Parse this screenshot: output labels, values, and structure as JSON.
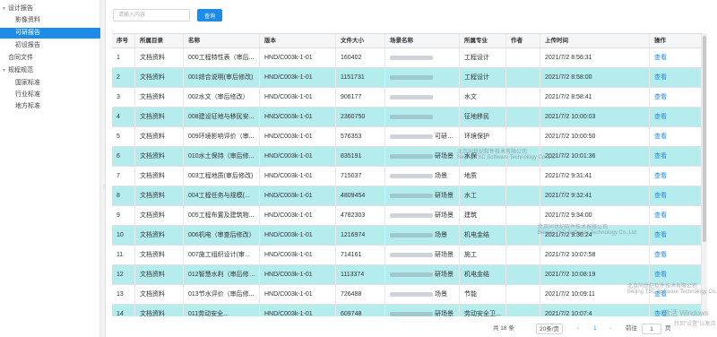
{
  "sidebar": {
    "items": [
      {
        "label": "设计报告",
        "level": 0,
        "expanded": true
      },
      {
        "label": "影像资料",
        "level": 1
      },
      {
        "label": "可研报告",
        "level": 1,
        "active": true
      },
      {
        "label": "初设报告",
        "level": 1
      },
      {
        "label": "合同文件",
        "level": 0
      },
      {
        "label": "规程规范",
        "level": 0,
        "expanded": true
      },
      {
        "label": "国家标准",
        "level": 1
      },
      {
        "label": "行业标准",
        "level": 1
      },
      {
        "label": "地方标准",
        "level": 1
      }
    ]
  },
  "search": {
    "placeholder": "请输入内容",
    "button_label": "查询"
  },
  "table": {
    "columns": [
      "序号",
      "所属目录",
      "名称",
      "版本",
      "文件大小",
      "场景名称",
      "所属专业",
      "作者",
      "上传时间",
      "操作"
    ],
    "rows": [
      {
        "no": "1",
        "dir": "文档资料",
        "name": "000工程特性表（审后...",
        "ver": "HND/C003k-1-01",
        "size": "160402",
        "scene": "",
        "major": "工程设计",
        "author": "",
        "time": "2021/7/2 8:56:31",
        "op": "查看"
      },
      {
        "no": "2",
        "dir": "文档资料",
        "name": "001综合说明(审后修改)",
        "ver": "HND/C003k-1-01",
        "size": "1151731",
        "scene": "",
        "major": "工程设计",
        "author": "",
        "time": "2021/7/2 8:58:00",
        "op": "查看"
      },
      {
        "no": "3",
        "dir": "文档资料",
        "name": "002水文（审后修改）",
        "ver": "HND/C003k-1-01",
        "size": "906177",
        "scene": "",
        "major": "水文",
        "author": "",
        "time": "2021/7/2 8:58:41",
        "op": "查看"
      },
      {
        "no": "4",
        "dir": "文档资料",
        "name": "008建设征地与移民安...",
        "ver": "HND/C003k-1-01",
        "size": "2360750",
        "scene": "",
        "major": "征地移民",
        "author": "",
        "time": "2021/7/2 10:00:03",
        "op": "查看"
      },
      {
        "no": "5",
        "dir": "文档资料",
        "name": "009环境影响评价（审...",
        "ver": "HND/C003k-1-01",
        "size": "576353",
        "scene": "可研场景",
        "major": "环境保护",
        "author": "",
        "time": "2021/7/2 10:00:50",
        "op": "查看"
      },
      {
        "no": "6",
        "dir": "文档资料",
        "name": "010水土保持（审后修...",
        "ver": "HND/C003k-1-01",
        "size": "835191",
        "scene": "研场景",
        "major": "水保",
        "author": "",
        "time": "2021/7/2 10:01:36",
        "op": "查看"
      },
      {
        "no": "7",
        "dir": "文档资料",
        "name": "003工程地质(审后修改)",
        "ver": "HND/C003k-1-01",
        "size": "715037",
        "scene": "场景",
        "major": "地质",
        "author": "",
        "time": "2021/7/2 9:31:41",
        "op": "查看"
      },
      {
        "no": "8",
        "dir": "文档资料",
        "name": "004工程任务与规模(...",
        "ver": "HND/C003k-1-01",
        "size": "4809454",
        "scene": "研场景",
        "major": "水工",
        "author": "",
        "time": "2021/7/2 9:32:41",
        "op": "查看"
      },
      {
        "no": "9",
        "dir": "文档资料",
        "name": "005工程布置及建筑物...",
        "ver": "HND/C003k-1-01",
        "size": "4782303",
        "scene": "研场景",
        "major": "建筑",
        "author": "",
        "time": "2021/7/2 9:34:00",
        "op": "查看"
      },
      {
        "no": "10",
        "dir": "文档资料",
        "name": "006机电（审查后修改）",
        "ver": "HND/C003k-1-01",
        "size": "1216974",
        "scene": "场景",
        "major": "机电金结",
        "author": "",
        "time": "2021/7/2 9:36:24",
        "op": "查看"
      },
      {
        "no": "11",
        "dir": "文档资料",
        "name": "007施工组织设计(审...",
        "ver": "HND/C003k-1-01",
        "size": "714161",
        "scene": "研场景",
        "major": "施工",
        "author": "",
        "time": "2021/7/2 10:07:58",
        "op": "查看"
      },
      {
        "no": "12",
        "dir": "文档资料",
        "name": "012智慧水利（审后修改）",
        "ver": "HND/C003k-1-01",
        "size": "1113374",
        "scene": "研场景",
        "major": "机电金结",
        "author": "",
        "time": "2021/7/2 10:08:19",
        "op": "查看"
      },
      {
        "no": "13",
        "dir": "文档资料",
        "name": "013节水评价（审后修...",
        "ver": "HND/C003k-1-01",
        "size": "726488",
        "scene": "场景",
        "major": "节能",
        "author": "",
        "time": "2021/7/2 10:09:11",
        "op": "查看"
      },
      {
        "no": "14",
        "dir": "文档资料",
        "name": "011劳动安全...",
        "ver": "HND/C003k-1-01",
        "size": "609748",
        "scene": "研场景",
        "major": "劳动安全卫...",
        "author": "",
        "time": "2021/7/2 10:07:4",
        "op": "查看"
      }
    ]
  },
  "pager": {
    "total": "共 18 条",
    "page_size": "20条/页",
    "prev": "‹",
    "current_page": "1",
    "next": "›",
    "goto_label": "前往",
    "goto_value": "1",
    "page_unit": "页"
  },
  "watermark": {
    "company_cn": "北京同世纪软件技术有限公司",
    "company_en": "Beijing TSC Software Technology Co.,Ltd",
    "activate_title": "激活 Windows",
    "activate_sub": "转到\"设置\"以激活 Windows。"
  },
  "colors": {
    "accent": "#1e8ce6",
    "row_highlight": "#b5ecee"
  }
}
